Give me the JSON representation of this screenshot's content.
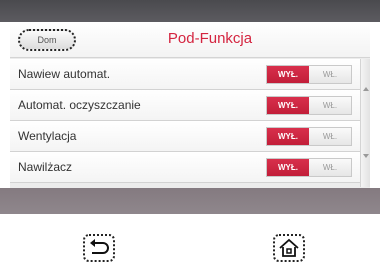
{
  "header": {
    "home_button_label": "Dom",
    "title": "Pod-Funkcja"
  },
  "rows": [
    {
      "label": "Nawiew automat.",
      "off_label": "WYŁ.",
      "on_label": "WŁ.",
      "state": "off"
    },
    {
      "label": "Automat. oczyszczanie",
      "off_label": "WYŁ.",
      "on_label": "WŁ.",
      "state": "off"
    },
    {
      "label": "Wentylacja",
      "off_label": "WYŁ.",
      "on_label": "WŁ.",
      "state": "off"
    },
    {
      "label": "Nawilżacz",
      "off_label": "WYŁ.",
      "on_label": "WŁ.",
      "state": "off"
    }
  ],
  "hardware_keys": {
    "back_icon": "back-arrow-icon",
    "home_icon": "home-icon"
  },
  "colors": {
    "accent": "#d42540",
    "toggle_off_active": "#c21e39"
  }
}
